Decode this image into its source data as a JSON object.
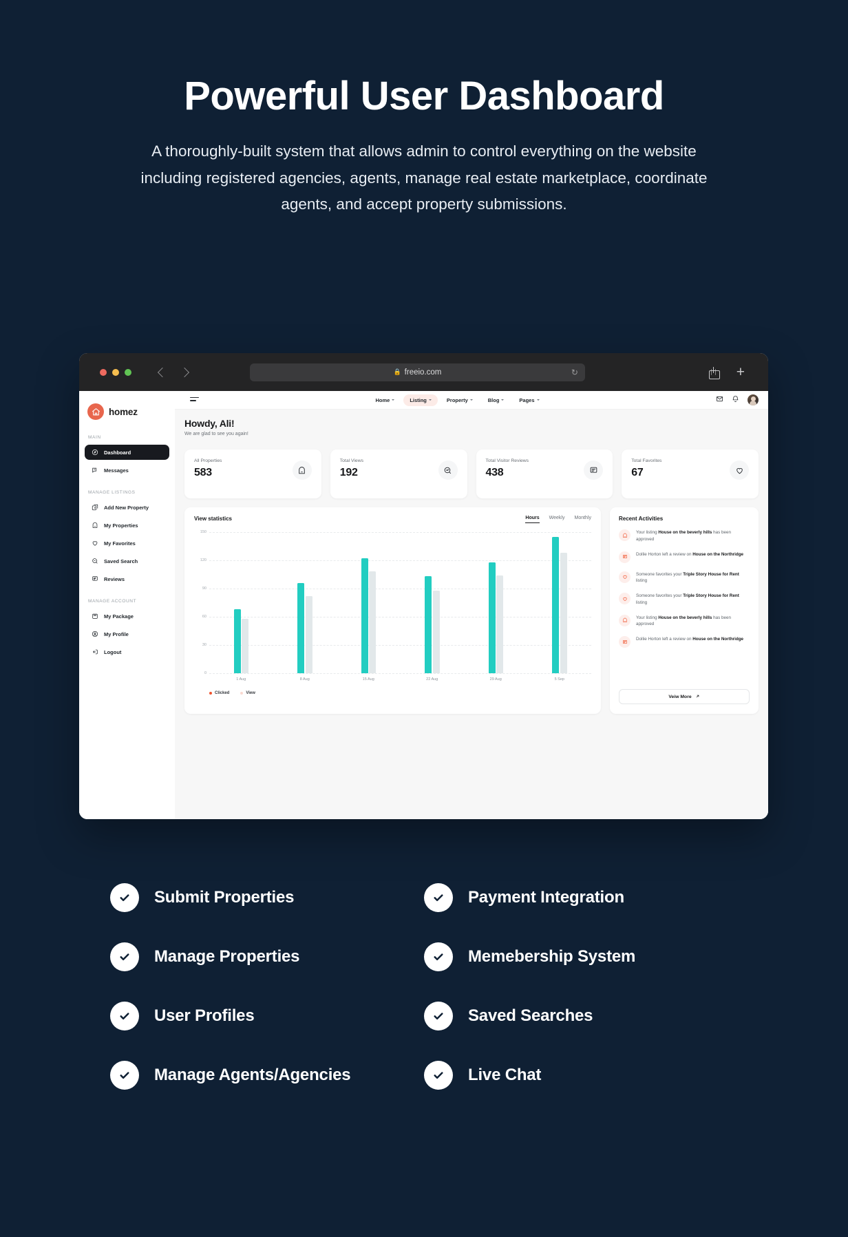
{
  "hero": {
    "title": "Powerful User Dashboard",
    "subtitle": "A thoroughly-built system that allows admin to control everything on the website including registered agencies, agents, manage real estate marketplace, coordinate agents, and accept property submissions."
  },
  "browser": {
    "url": "freeio.com",
    "lock_icon": "lock-icon",
    "reload_icon": "reload-icon",
    "share_icon": "share-icon",
    "new_tab_icon": "plus-icon"
  },
  "app": {
    "brand": "homez",
    "sidebar": {
      "sections": [
        {
          "label": "MAIN",
          "items": [
            {
              "label": "Dashboard",
              "icon": "compass-icon",
              "active": true
            },
            {
              "label": "Messages",
              "icon": "message-icon",
              "active": false
            }
          ]
        },
        {
          "label": "MANAGE LISTINGS",
          "items": [
            {
              "label": "Add New Property",
              "icon": "add-square-icon",
              "active": false
            },
            {
              "label": "My Properties",
              "icon": "home-tag-icon",
              "active": false
            },
            {
              "label": "My Favorites",
              "icon": "heart-icon",
              "active": false
            },
            {
              "label": "Saved Search",
              "icon": "search-icon",
              "active": false
            },
            {
              "label": "Reviews",
              "icon": "review-icon",
              "active": false
            }
          ]
        },
        {
          "label": "MANAGE ACCOUNT",
          "items": [
            {
              "label": "My Package",
              "icon": "package-icon",
              "active": false
            },
            {
              "label": "My Profile",
              "icon": "user-circle-icon",
              "active": false
            },
            {
              "label": "Logout",
              "icon": "logout-icon",
              "active": false
            }
          ]
        }
      ]
    },
    "topnav": {
      "menu_icon": "hamburger-icon",
      "items": [
        {
          "label": "Home",
          "active": false
        },
        {
          "label": "Listing",
          "active": true
        },
        {
          "label": "Property",
          "active": false
        },
        {
          "label": "Blog",
          "active": false
        },
        {
          "label": "Pages",
          "active": false
        }
      ],
      "mail_icon": "envelope-icon",
      "bell_icon": "bell-icon",
      "avatar": "user-avatar"
    },
    "greeting": {
      "title": "Howdy, Ali!",
      "subtitle": "We are glad to see you again!"
    },
    "stats": [
      {
        "label": "All Properties",
        "value": "583",
        "icon": "home-tag-icon"
      },
      {
        "label": "Total Views",
        "value": "192",
        "icon": "search-chart-icon"
      },
      {
        "label": "Total Visitor Reviews",
        "value": "438",
        "icon": "review-icon"
      },
      {
        "label": "Total Favorites",
        "value": "67",
        "icon": "heart-icon"
      }
    ],
    "chart_panel": {
      "title": "View statistics",
      "tabs": [
        {
          "label": "Hours",
          "active": true
        },
        {
          "label": "Weekly",
          "active": false
        },
        {
          "label": "Monthly",
          "active": false
        }
      ]
    },
    "activities": {
      "title": "Recent Activities",
      "items": [
        {
          "icon": "home-tag-icon",
          "pre": "Your listing ",
          "strong": "House on the beverly hills",
          "post": " has been approved"
        },
        {
          "icon": "review-icon",
          "pre": "Dollie Horton left a review on ",
          "strong": "House on the Northridge",
          "post": ""
        },
        {
          "icon": "heart-icon",
          "pre": "Someone favorites your ",
          "strong": "Triple Story House for Rent",
          "post": " listing"
        },
        {
          "icon": "heart-icon",
          "pre": "Someone favorites your ",
          "strong": "Triple Story House for Rent",
          "post": " listing"
        },
        {
          "icon": "home-tag-icon",
          "pre": "Your listing ",
          "strong": "House on the beverly hills",
          "post": " has been approved"
        },
        {
          "icon": "review-icon",
          "pre": "Dollie Horton left a review on ",
          "strong": "House on the Northridge",
          "post": ""
        }
      ],
      "view_more": "Veiw More",
      "view_more_icon": "arrow-up-right-icon"
    }
  },
  "chart_data": {
    "type": "bar",
    "title": "View statistics",
    "categories": [
      "1 Aug",
      "8 Aug",
      "15 Aug",
      "22 Aug",
      "29 Aug",
      "5 Sep"
    ],
    "series": [
      {
        "name": "Clicked",
        "color": "#22cdc1",
        "values": [
          68,
          96,
          122,
          103,
          118,
          145
        ]
      },
      {
        "name": "View",
        "color": "#e2e8ea",
        "values": [
          58,
          82,
          108,
          88,
          104,
          128
        ]
      }
    ],
    "ylim": [
      0,
      150
    ],
    "yticks": [
      0,
      30,
      60,
      90,
      120,
      150
    ],
    "xlabel": "",
    "ylabel": "",
    "grid": true,
    "legend": [
      "Clicked",
      "View"
    ],
    "legend_position": "bottom-left"
  },
  "features": [
    {
      "label": "Submit Properties"
    },
    {
      "label": "Payment Integration"
    },
    {
      "label": "Manage Properties"
    },
    {
      "label": "Memebership System"
    },
    {
      "label": "User Profiles"
    },
    {
      "label": "Saved Searches"
    },
    {
      "label": "Manage Agents/Agencies"
    },
    {
      "label": "Live Chat"
    }
  ]
}
